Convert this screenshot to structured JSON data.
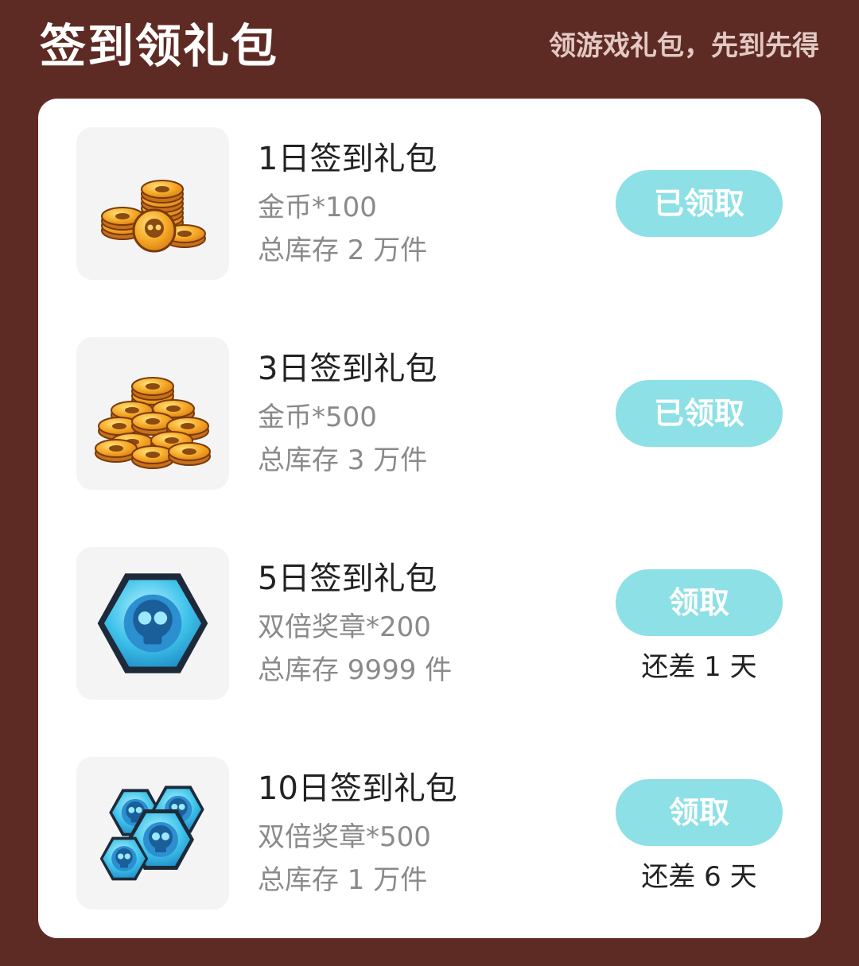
{
  "header": {
    "title": "签到领礼包",
    "subtitle": "领游戏礼包，先到先得"
  },
  "items": [
    {
      "title": "1日签到礼包",
      "reward": "金币*100",
      "stock": "总库存 2 万件",
      "button_label": "已领取",
      "status": "claimed",
      "remaining": "",
      "icon": "gold-coins-small-stack-icon"
    },
    {
      "title": "3日签到礼包",
      "reward": "金币*500",
      "stock": "总库存 3 万件",
      "button_label": "已领取",
      "status": "claimed",
      "remaining": "",
      "icon": "gold-coins-large-pile-icon"
    },
    {
      "title": "5日签到礼包",
      "reward": "双倍奖章*200",
      "stock": "总库存 9999 件",
      "button_label": "领取",
      "status": "pending",
      "remaining": "还差 1 天",
      "icon": "blue-skull-medal-icon"
    },
    {
      "title": "10日签到礼包",
      "reward": "双倍奖章*500",
      "stock": "总库存 1 万件",
      "button_label": "领取",
      "status": "pending",
      "remaining": "还差 6 天",
      "icon": "blue-skull-medals-pile-icon"
    }
  ],
  "colors": {
    "background": "#5e2b24",
    "card": "#ffffff",
    "button": "#8de0e6",
    "thumb_bg": "#f4f4f4",
    "coin": "#f5a623",
    "medal": "#3fc3ea"
  }
}
